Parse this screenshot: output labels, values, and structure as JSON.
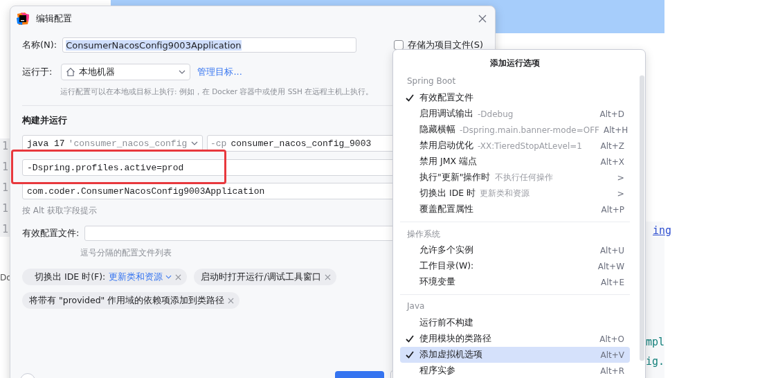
{
  "editor": {
    "gutter": [
      "1",
      "1",
      "1",
      "1",
      "1"
    ],
    "left_fragment": "Do",
    "right_fragments": [
      {
        "text": "ing",
        "kind": "link"
      },
      {
        "text": "mpl",
        "kind": "code"
      },
      {
        "text": "ig.",
        "kind": "code"
      }
    ]
  },
  "dialog": {
    "title": "编辑配置",
    "name_label": "名称(N):",
    "name_value": "ConsumerNacosConfig9003Application",
    "store_checkbox": {
      "label": "存储为项目文件(S)",
      "checked": false
    },
    "run_on_label": "运行于:",
    "run_on_value": "本地机器",
    "manage_link": "管理目标...",
    "run_on_hint": "运行配置可以在本地或目标上执行: 例如，在 Docker 容器中或使用 SSH 在远程主机上执行。",
    "section": "构建并运行",
    "jre": {
      "value": "java 17",
      "hint": "'consumer_nacos_config"
    },
    "classpath": {
      "prefix": "-cp",
      "value": "consumer_nacos_config_9003"
    },
    "vm_options": "-Dspring.profiles.active=prod",
    "main_class": "com.coder.ConsumerNacosConfig9003Application",
    "alt_hint": "按 Alt 获取字段提示",
    "profiles_label": "有效配置文件:",
    "profiles_hint": "逗号分隔的配置文件列表",
    "chips": [
      {
        "label": "切换出 IDE 时(F):",
        "value": "更新类和资源"
      },
      {
        "label": "启动时打开运行/调试工具窗口"
      },
      {
        "label": "将带有 \"provided\" 作用域的依赖项添加到类路径"
      }
    ],
    "footer_buttons": [
      {
        "kind": "help"
      },
      {
        "kind": "confirm"
      },
      {
        "kind": "cancel"
      }
    ]
  },
  "menu": {
    "title": "添加运行选项",
    "sections": [
      {
        "title": "Spring Boot",
        "items": [
          {
            "label": "有效配置文件",
            "checked": true,
            "selected": false
          },
          {
            "label": "启用调试输出",
            "hint": "-Ddebug",
            "shortcut": "Alt+D",
            "checked": false,
            "selected": false
          },
          {
            "label": "隐藏横幅",
            "hint": "-Dspring.main.banner-mode=OFF",
            "shortcut": "Alt+H",
            "checked": false,
            "selected": false
          },
          {
            "label": "禁用启动优化",
            "hint": "-XX:TieredStopAtLevel=1",
            "shortcut": "Alt+Z",
            "checked": false,
            "selected": false
          },
          {
            "label": "禁用 JMX 端点",
            "shortcut": "Alt+X",
            "checked": false,
            "selected": false
          },
          {
            "label": "执行\"更新\"操作时",
            "hint": "不执行任何操作",
            "arrow": ">",
            "checked": false,
            "selected": false
          },
          {
            "label": "切换出 IDE 时",
            "hint": "更新类和资源",
            "arrow": ">",
            "checked": false,
            "selected": false
          },
          {
            "label": "覆盖配置属性",
            "shortcut": "Alt+P",
            "checked": false,
            "selected": false
          }
        ]
      },
      {
        "title": "操作系统",
        "items": [
          {
            "label": "允许多个实例",
            "shortcut": "Alt+U",
            "checked": false,
            "selected": false
          },
          {
            "label": "工作目录(W):",
            "shortcut": "Alt+W",
            "checked": false,
            "selected": false
          },
          {
            "label": "环境变量",
            "shortcut": "Alt+E",
            "checked": false,
            "selected": false
          }
        ]
      },
      {
        "title": "Java",
        "items": [
          {
            "label": "运行前不构建",
            "checked": false,
            "selected": false
          },
          {
            "label": "使用模块的类路径",
            "shortcut": "Alt+O",
            "checked": true,
            "selected": false
          },
          {
            "label": "添加虚拟机选项",
            "shortcut": "Alt+V",
            "checked": true,
            "selected": true
          },
          {
            "label": "程序实参",
            "shortcut": "Alt+R",
            "checked": false,
            "selected": false
          }
        ]
      }
    ]
  }
}
